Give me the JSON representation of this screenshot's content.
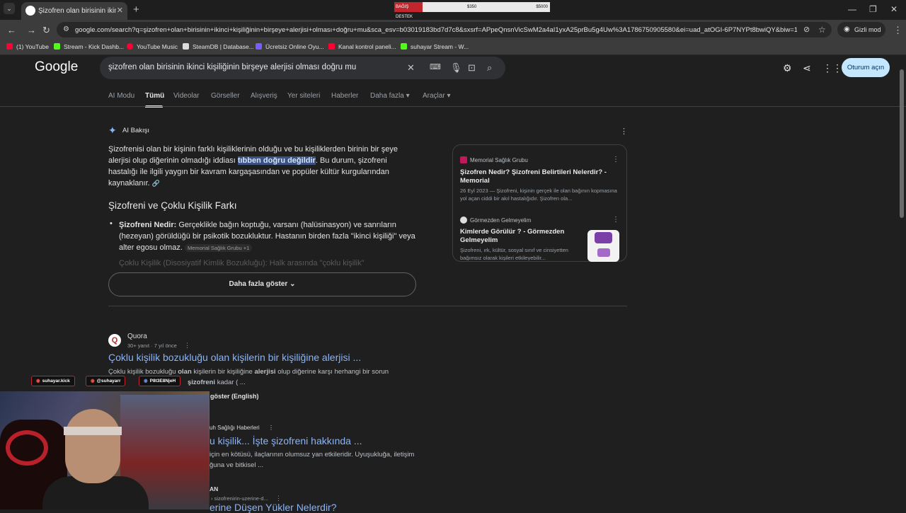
{
  "browser": {
    "tab_title": "Şizofren olan birisinin ikinci kişiliği",
    "url": "google.com/search?q=şizofren+olan+birisinin+ikinci+kişiliğinin+birşeye+alerjisi+olması+doğru+mu&sca_esv=b03019183bd7d7c8&sxsrf=APpeQnsnVicSwM2a4aI1yxA25prBu5g4Uw%3A1786750905580&ei=uad_atOGI-6P7NYPt8bwiQY&biw=192...",
    "incognito_label": "Gizli mod",
    "bookmarks": [
      {
        "label": "(1) YouTube",
        "color": "#ff0033"
      },
      {
        "label": "Stream - Kick Dashb...",
        "color": "#53fc18"
      },
      {
        "label": "YouTube Music",
        "color": "#ff0033"
      },
      {
        "label": "SteamDB | Database...",
        "color": "#dddddd"
      },
      {
        "label": "Ücretsiz Online Oyu...",
        "color": "#7a5cff"
      },
      {
        "label": "Kanal kontrol paneli...",
        "color": "#ff0033"
      },
      {
        "label": "suhayar Stream - W...",
        "color": "#53fc18"
      }
    ],
    "donation": {
      "label": "BAĞIŞ DESTEK",
      "current": "$350",
      "goal": "$5000"
    }
  },
  "google": {
    "logo": "Google",
    "query": "şizofren olan birisinin ikinci kişiliğinin birşeye alerjisi olması doğru mu",
    "signin_label": "Oturum açın",
    "tabs": [
      "AI Modu",
      "Tümü",
      "Videolar",
      "Görseller",
      "Alışveriş",
      "Yer siteleri",
      "Haberler",
      "Daha fazla ▾",
      "Araçlar ▾"
    ]
  },
  "ai_overview": {
    "title": "AI Bakışı",
    "para_before": "Şizofrenisi olan bir kişinin farklı kişiliklerinin olduğu ve bu kişiliklerden birinin bir şeye alerjisi olup diğerinin olmadığı iddiası ",
    "para_highlight": "tıbben doğru değildir",
    "para_after": ". Bu durum, şizofreni hastalığı ile ilgili yaygın bir kavram kargaşasından ve popüler kültür kurgularından kaynaklanır.",
    "heading": "Şizofreni ve Çoklu Kişilik Farkı",
    "bullet_bold": "Şizofreni Nedir:",
    "bullet_text": " Gerçeklikle bağın koptuğu, varsanı (halüsinasyon) ve sanrıların (hezeyan) görüldüğü bir psikotik bozukluktur. Hastanın birden fazla \"ikinci kişiliği\" veya alter egosu olmaz.",
    "bullet_source": "Memorial Sağlık Grubu +1",
    "faded_text": "Çoklu Kişilik (Disosiyatif Kimlik Bozukluğu): Halk arasında \"çoklu kişilik\"",
    "more_label": "Daha fazla göster"
  },
  "sources_card": {
    "items": [
      {
        "source": "Memorial Sağlık Grubu",
        "title": "Şizofren Nedir? Şizofreni Belirtileri Nelerdir? - Memorial",
        "snippet": "26 Eyl 2023 — Şizofreni, kişinin gerçek ile olan bağının kopmasına yol açan ciddi bir akıl hastalığıdır. Şizofren ola..."
      },
      {
        "source": "Görmezden Gelmeyelim",
        "title": "Kimlerde Görülür ? - Görmezden Gelmeyelim",
        "snippet": "Şizofreni, ırk, kültür, sosyal sınıf ve cinsiyetten bağımsız olarak kişileri etkileyebilir..."
      }
    ]
  },
  "results": {
    "r1": {
      "source": "Quora",
      "meta": "30+ yanıt · 7 yıl önce",
      "title": "Çoklu kişilik bozukluğu olan kişilerin bir kişiliğine alerjisi ...",
      "snippet_a": "Çoklu kişilik bozukluğu ",
      "snippet_b1": "olan",
      "snippet_c": " kişilerin bir kişiliğine ",
      "snippet_b2": "alerjisi",
      "snippet_d": " olup diğerine karşı herhangi bir sorun",
      "snippet_line2_bold": "şizofreni",
      "snippet_line2_rest": " kadar ( ..."
    },
    "r2_more": "göster (English)",
    "r3": {
      "source": "uh Sağlığı Haberleri",
      "title": "u kişilik... İşte şizofreni hakkında ...",
      "snippet": "için en kötüsü, ilaçlarının olumsuz yan etkileridir. Uyuşukluğa, iletişim ğuna ve bitkisel ..."
    },
    "r4": {
      "source": "AN",
      "url": "› sizofrenirin-uzerine-d...",
      "title": "erine Düşen Yükler Nelerdir?"
    }
  },
  "stream_overlay": {
    "socials": [
      "suhayar.kick",
      "@suhayarr",
      "P8t3E8NjeH"
    ]
  }
}
